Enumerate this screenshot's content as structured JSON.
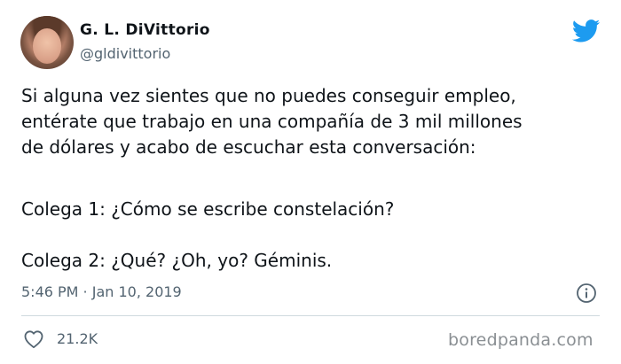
{
  "tweet": {
    "author": {
      "name": "G. L. DiVittorio",
      "handle": "@gldivittorio"
    },
    "text": {
      "line1": " Si alguna vez sientes que no puedes conseguir empleo,\nentérate que trabajo en una compañía de 3 mil millones\nde dólares y acabo de escuchar esta conversación:",
      "line2": "Colega 1: ¿Cómo se escribe constelación?",
      "line3": "Colega 2: ¿Qué? ¿Oh, yo? Géminis."
    },
    "timestamp": "5:46 PM · Jan 10, 2019",
    "likes": "21.2K"
  },
  "watermark": "boredpanda.com",
  "colors": {
    "twitter_blue": "#1d9bf0",
    "secondary_text": "#536471",
    "primary_text": "#0f1419",
    "divider": "#cfd9de"
  },
  "icons": {
    "brand": "twitter-bird-icon",
    "info": "info-icon",
    "like": "heart-icon"
  }
}
